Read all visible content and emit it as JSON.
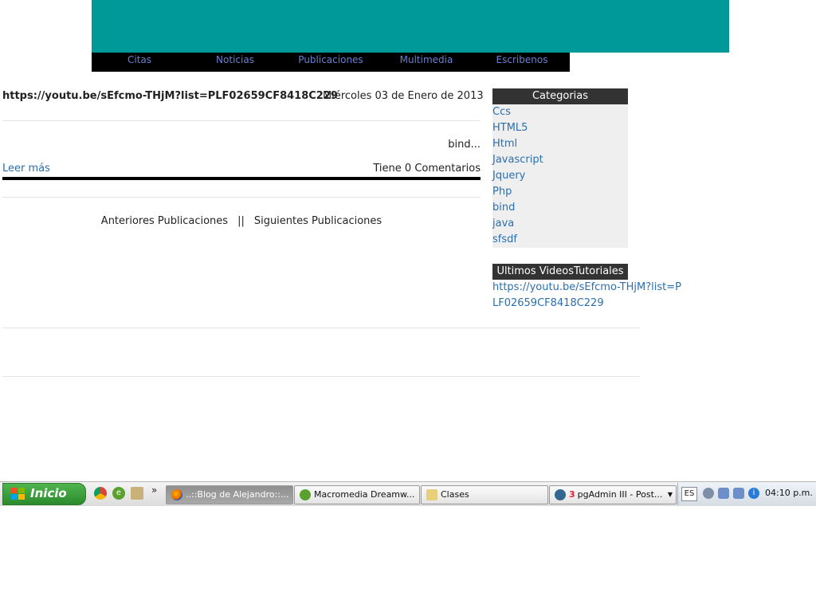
{
  "header": {
    "banner_color": "#009999",
    "nav": [
      "Citas",
      "Noticias",
      "Publicaciones",
      "Multimedia",
      "Escribenos"
    ]
  },
  "post": {
    "title_link": "https://youtu.be/sEfcmo-THjM?list=PLF02659CF8418C229",
    "date": "Miércoles 03 de Enero de 2013",
    "excerpt": "bind...",
    "read_more": "Leer más",
    "comments": "Tiene 0 Comentarios"
  },
  "pager": {
    "previous": "Anteriores Publicaciones",
    "separator": "||",
    "next": "Siguientes Publicaciones"
  },
  "sidebar": {
    "categories_title": "Categorias",
    "categories": [
      "Ccs",
      "HTML5",
      "Html",
      "Javascript",
      "Jquery",
      "Php",
      "bind",
      "java",
      "sfsdf"
    ],
    "videos_title": "Ultimos VideosTutoriales",
    "video_link": "https://youtu.be/sEfcmo-THjM?list=PLF02659CF8418C229"
  },
  "taskbar": {
    "start_label": "Inicio",
    "overflow": "»",
    "tasks": [
      {
        "label": "..::Blog de Alejandro::...",
        "icon": "firefox-icon"
      },
      {
        "label": "Macromedia Dreamw...",
        "icon": "dreamweaver-icon"
      },
      {
        "label": "Clases",
        "icon": "folder-icon"
      },
      {
        "label": "pgAdmin III - Post...",
        "icon": "pgadmin-icon",
        "count": "3"
      }
    ],
    "language": "ES",
    "clock": "04:10 p.m."
  }
}
